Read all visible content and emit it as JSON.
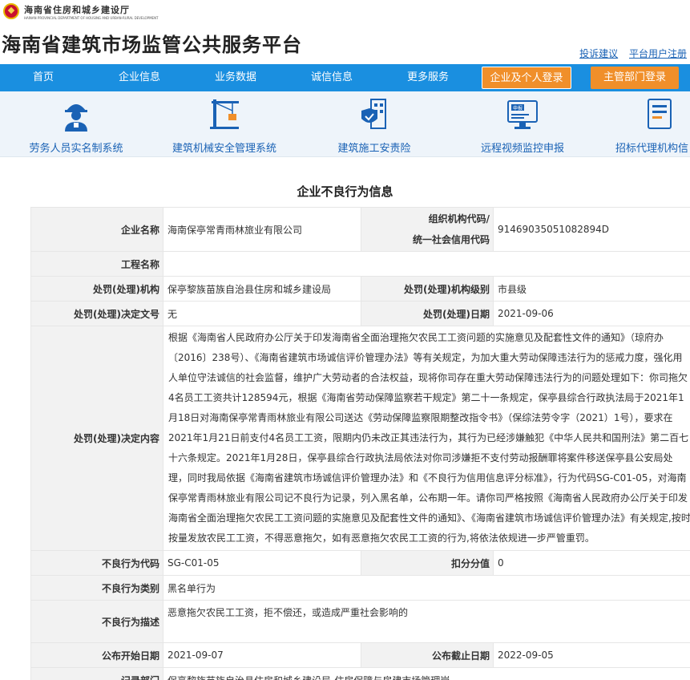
{
  "header": {
    "dept_name": "海南省住房和城乡建设厅",
    "dept_name_en": "HAINAN PROVINCIAL DEPARTMENT OF HOUSING AND URBAN-RURAL DEVELOPMENT",
    "site_title": "海南省建筑市场监管公共服务平台",
    "links": [
      "投诉建议",
      "平台用户注册"
    ]
  },
  "nav": {
    "items": [
      "首页",
      "企业信息",
      "业务数据",
      "诚信信息",
      "更多服务"
    ],
    "login_company": "企业及个人登录",
    "login_admin": "主管部门登录"
  },
  "systems": [
    {
      "label": "劳务人员实名制系统",
      "icon": "worker-icon"
    },
    {
      "label": "建筑机械安全管理系统",
      "icon": "crane-icon"
    },
    {
      "label": "建筑施工安责险",
      "icon": "building-shield-icon"
    },
    {
      "label": "远程视频监控申报",
      "icon": "monitor-declare-icon"
    },
    {
      "label": "招标代理机构信",
      "icon": "document-icon"
    }
  ],
  "page_title": "企业不良行为信息",
  "record": {
    "company_name_label": "企业名称",
    "company_name": "海南保亭常青雨林旅业有限公司",
    "org_code_label_1": "组织机构代码/",
    "org_code_label_2": "统一社会信用代码",
    "org_code": "91469035051082894D",
    "project_label": "工程名称",
    "project": "",
    "agency_label": "处罚(处理)机构",
    "agency": "保亭黎族苗族自治县住房和城乡建设局",
    "agency_level_label": "处罚(处理)机构级别",
    "agency_level": "市县级",
    "doc_no_label": "处罚(处理)决定文号",
    "doc_no": "无",
    "decision_date_label": "处罚(处理)日期",
    "decision_date": "2021-09-06",
    "content_label": "处罚(处理)决定内容",
    "content": "根据《海南省人民政府办公厅关于印发海南省全面治理拖欠农民工工资问题的实施意见及配套性文件的通知》（琼府办〔2016〕238号）、《海南省建筑市场诚信评价管理办法》等有关规定，为加大重大劳动保障违法行为的惩戒力度，强化用人单位守法诚信的社会监督，维护广大劳动者的合法权益，现将你司存在重大劳动保障违法行为的问题处理如下：你司拖欠4名员工工资共计128594元，根据《海南省劳动保障监察若干规定》第二十一条规定，保亭县综合行政执法局于2021年1月18日对海南保亭常青雨林旅业有限公司送达《劳动保障监察限期整改指令书》（保综法劳令字（2021）1号），要求在2021年1月21日前支付4名员工工资，限期内仍未改正其违法行为，其行为已经涉嫌触犯《中华人民共和国刑法》第二百七十六条规定。2021年1月28日，保亭县综合行政执法局依法对你司涉嫌拒不支付劳动报酬罪将案件移送保亭县公安局处理，同时我局依据《海南省建筑市场诚信评价管理办法》和《不良行为信用信息评分标准》，行为代码SG-C01-05，对海南保亭常青雨林旅业有限公司记不良行为记录，列入黑名单，公布期一年。请你司严格按照《海南省人民政府办公厅关于印发海南省全面治理拖欠农民工工资问题的实施意见及配套性文件的通知》、《海南省建筑市场诚信评价管理办法》有关规定,按时按量发放农民工工资，不得恶意拖欠，如有恶意拖欠农民工工资的行为,将依法依规进一步严管重罚。",
    "behavior_code_label": "不良行为代码",
    "behavior_code": "SG-C01-05",
    "score_label": "扣分分值",
    "score": "0",
    "category_label": "不良行为类别",
    "category": "黑名单行为",
    "description_label": "不良行为描述",
    "description": "恶意拖欠农民工工资，拒不偿还，或造成严重社会影响的",
    "pub_start_label": "公布开始日期",
    "pub_start": "2021-09-07",
    "pub_end_label": "公布截止日期",
    "pub_end": "2022-09-05",
    "record_dept_label": "记录部门",
    "record_dept": "保亭黎族苗族自治县住房和城乡建设局-住房保障与房建市场管理岗"
  }
}
